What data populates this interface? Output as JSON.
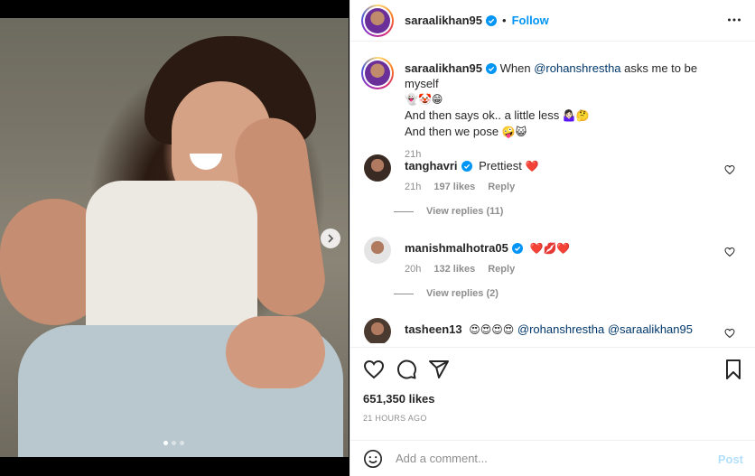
{
  "header": {
    "username": "saraalikhan95",
    "separator": "•",
    "follow_label": "Follow",
    "more_icon": "more-horizontal-icon"
  },
  "caption": {
    "username": "saraalikhan95",
    "text_prefix": "When ",
    "mention": "@rohanshrestha",
    "text_suffix": " asks me to be myself",
    "line1_emojis": "👻🤡😁",
    "line2": "And then says ok.. a little less",
    "line2_emojis": "🤷🏻‍♀️🤔",
    "line3": "And then we pose",
    "line3_emojis": "🤪😺",
    "time": "21h"
  },
  "comments": [
    {
      "username": "tanghavri",
      "text": "Prettiest",
      "emojis": "❤️",
      "time": "21h",
      "likes": "197 likes",
      "reply_label": "Reply",
      "view_replies": "View replies (11)"
    },
    {
      "username": "manishmalhotra05",
      "text": "",
      "emojis": "❤️💋❤️",
      "time": "20h",
      "likes": "132 likes",
      "reply_label": "Reply",
      "view_replies": "View replies (2)"
    },
    {
      "username": "tasheen13",
      "emojis": "😍😍😍😍",
      "mention1": "@rohanshrestha",
      "mention2": "@saraalikhan95"
    }
  ],
  "likes": "651,350 likes",
  "timestamp": "21 HOURS AGO",
  "add_comment": {
    "placeholder": "Add a comment...",
    "post_label": "Post"
  },
  "carousel": {
    "current": 1,
    "total": 3
  },
  "colors": {
    "accent": "#0095f6",
    "post_disabled": "#b2dffc",
    "verified": "#0095f6",
    "heart": "#ed4956"
  }
}
